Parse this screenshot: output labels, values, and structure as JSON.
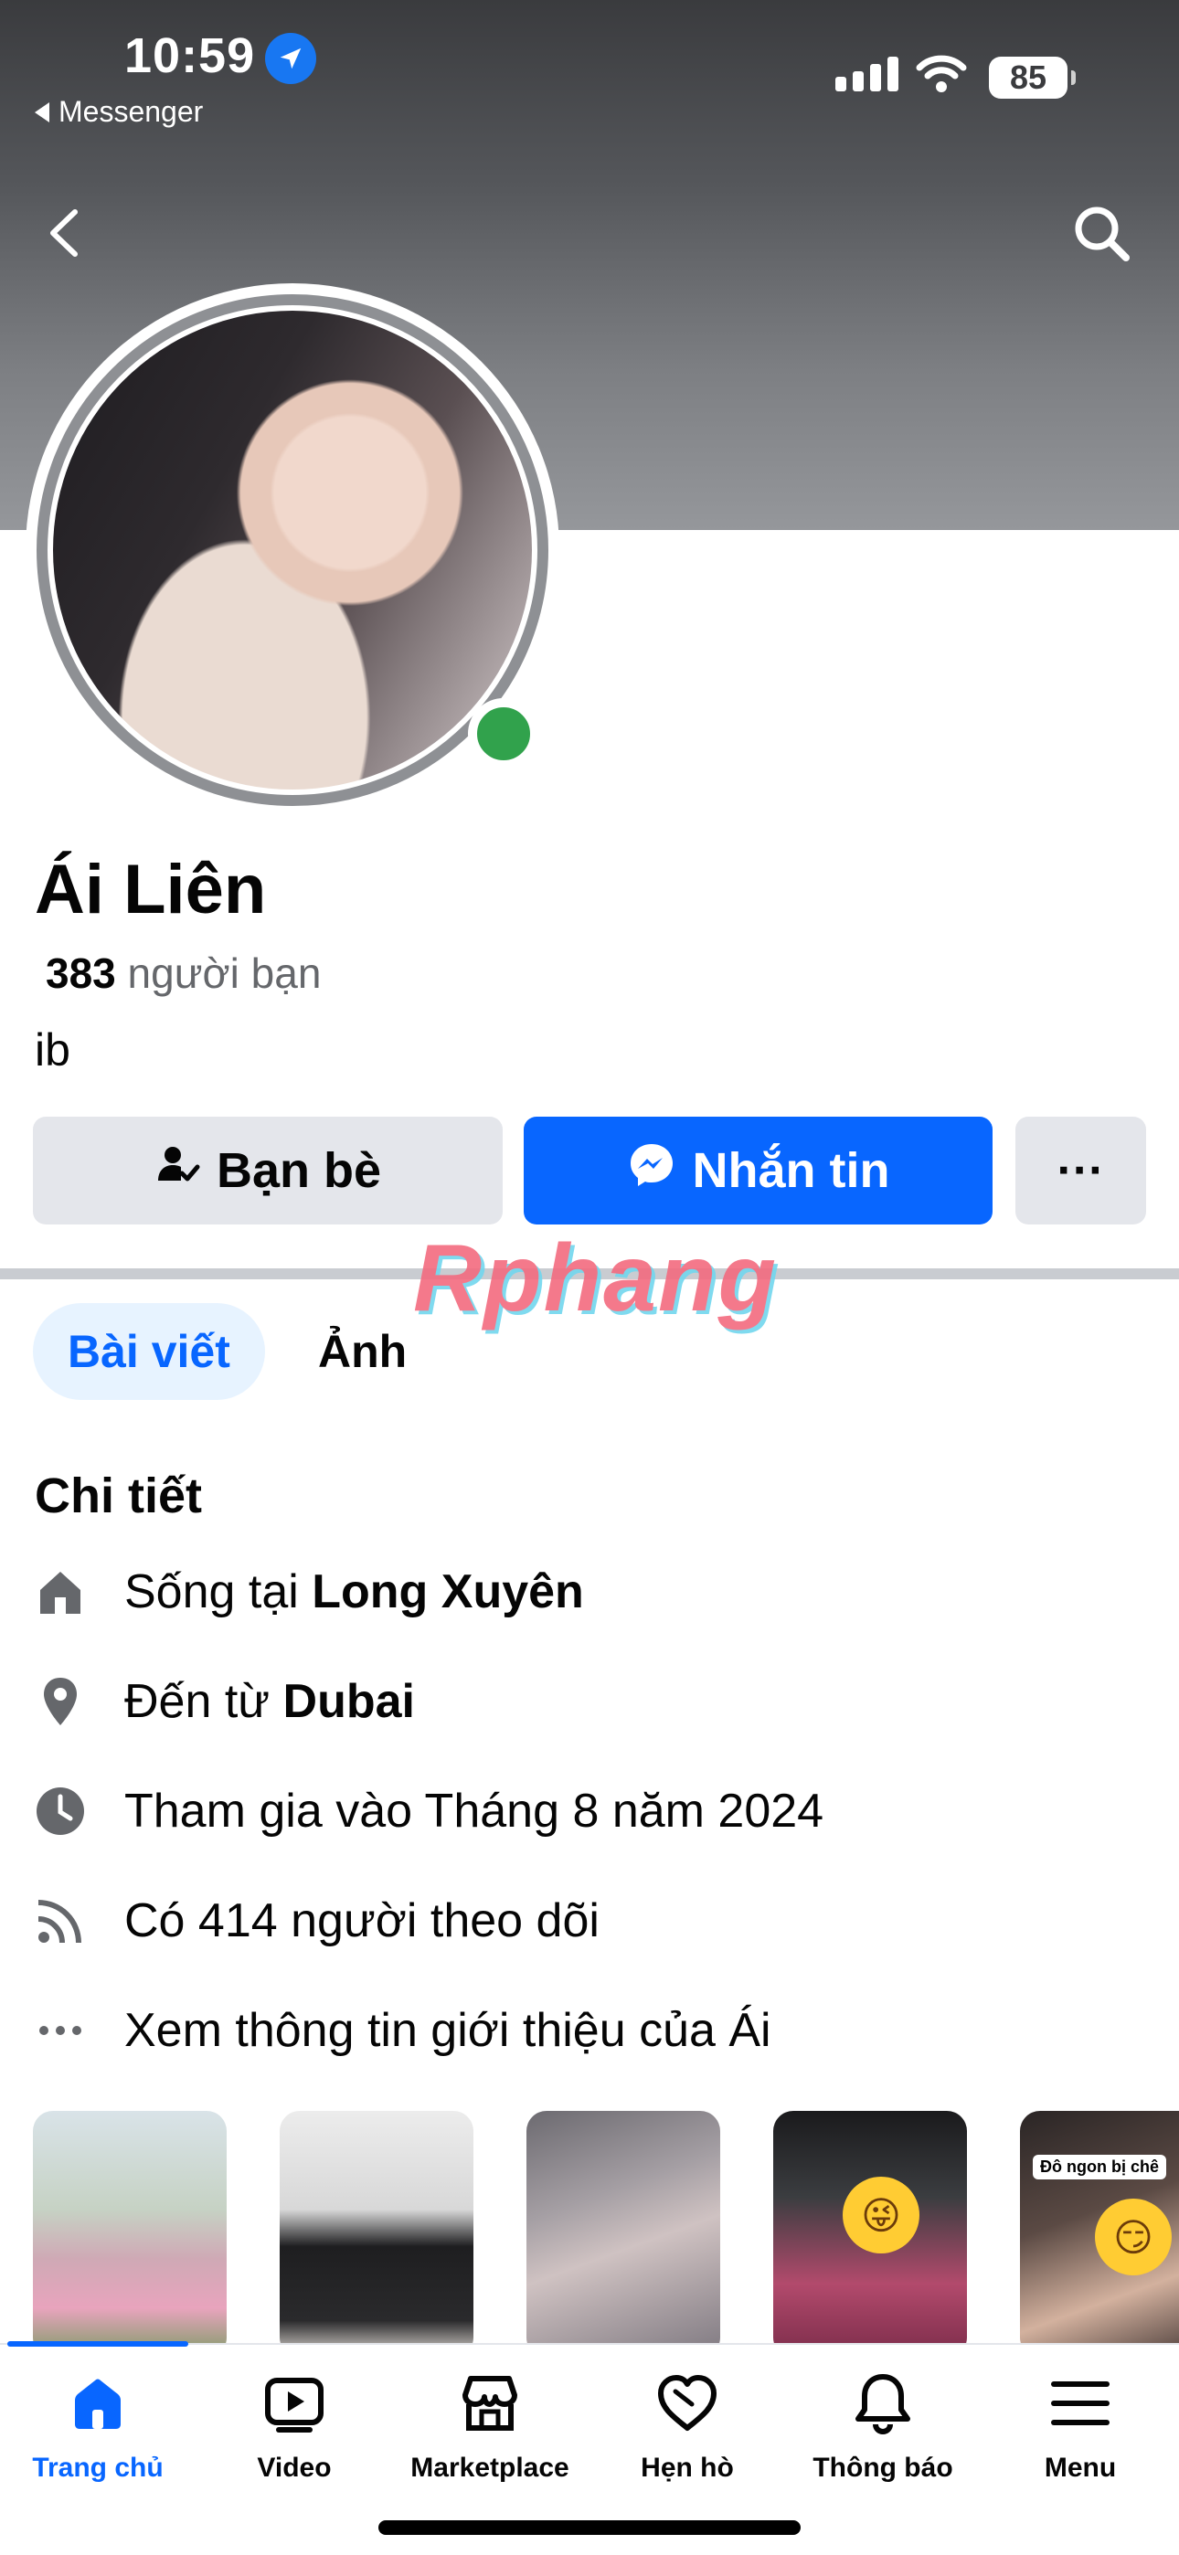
{
  "status_bar": {
    "time": "10:59",
    "back_app": "Messenger",
    "battery": "85"
  },
  "profile": {
    "name": "Ái Liên",
    "friends_count": "383",
    "friends_label": "người bạn",
    "bio": "ib"
  },
  "actions": {
    "friends_label": "Bạn bè",
    "message_label": "Nhắn tin",
    "more_label": "···"
  },
  "watermark": "Rphang",
  "tabs": [
    {
      "label": "Bài viết",
      "active": true
    },
    {
      "label": "Ảnh",
      "active": false
    }
  ],
  "details": {
    "title": "Chi tiết",
    "lives_prefix": "Sống tại ",
    "lives_city": "Long Xuyên",
    "from_prefix": "Đến từ ",
    "from_city": "Dubai",
    "joined": "Tham gia vào Tháng 8 năm 2024",
    "followers": "Có 414 người theo dõi",
    "see_about": "Xem thông tin giới thiệu của Ái"
  },
  "thumbnails": {
    "caption_5": "Đô ngon bị chê"
  },
  "bottom_nav": [
    {
      "label": "Trang chủ",
      "icon": "home-icon",
      "active": true
    },
    {
      "label": "Video",
      "icon": "video-icon",
      "active": false
    },
    {
      "label": "Marketplace",
      "icon": "marketplace-icon",
      "active": false
    },
    {
      "label": "Hẹn hò",
      "icon": "dating-icon",
      "active": false
    },
    {
      "label": "Thông báo",
      "icon": "bell-icon",
      "active": false
    },
    {
      "label": "Menu",
      "icon": "menu-icon",
      "active": false
    }
  ],
  "colors": {
    "accent": "#0866ff",
    "online": "#31a24c",
    "button_gray": "#e4e6eb",
    "tab_active_bg": "#e7f3ff"
  }
}
